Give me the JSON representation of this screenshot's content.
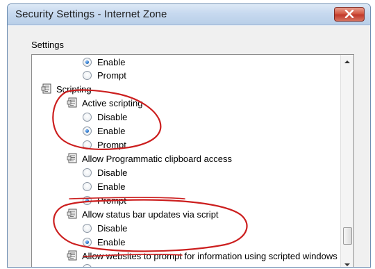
{
  "window": {
    "title": "Security Settings - Internet Zone",
    "close_icon": "close-icon"
  },
  "settings_label": "Settings",
  "tree": {
    "items": [
      {
        "kind": "option",
        "label": "Enable",
        "checked": true
      },
      {
        "kind": "option",
        "label": "Prompt",
        "checked": false
      },
      {
        "kind": "category",
        "label": "Scripting"
      },
      {
        "kind": "setting",
        "label": "Active scripting"
      },
      {
        "kind": "option",
        "label": "Disable",
        "checked": false
      },
      {
        "kind": "option",
        "label": "Enable",
        "checked": true
      },
      {
        "kind": "option",
        "label": "Prompt",
        "checked": false
      },
      {
        "kind": "setting",
        "label": "Allow Programmatic clipboard access"
      },
      {
        "kind": "option",
        "label": "Disable",
        "checked": false
      },
      {
        "kind": "option",
        "label": "Enable",
        "checked": false
      },
      {
        "kind": "option",
        "label": "Prompt",
        "checked": true
      },
      {
        "kind": "setting",
        "label": "Allow status bar updates via script"
      },
      {
        "kind": "option",
        "label": "Disable",
        "checked": false
      },
      {
        "kind": "option",
        "label": "Enable",
        "checked": true
      },
      {
        "kind": "setting",
        "label": "Allow websites to prompt for information using scripted windows"
      }
    ]
  },
  "colors": {
    "annotation": "#cc1f1f",
    "radio_checked": "#2a75c9"
  }
}
